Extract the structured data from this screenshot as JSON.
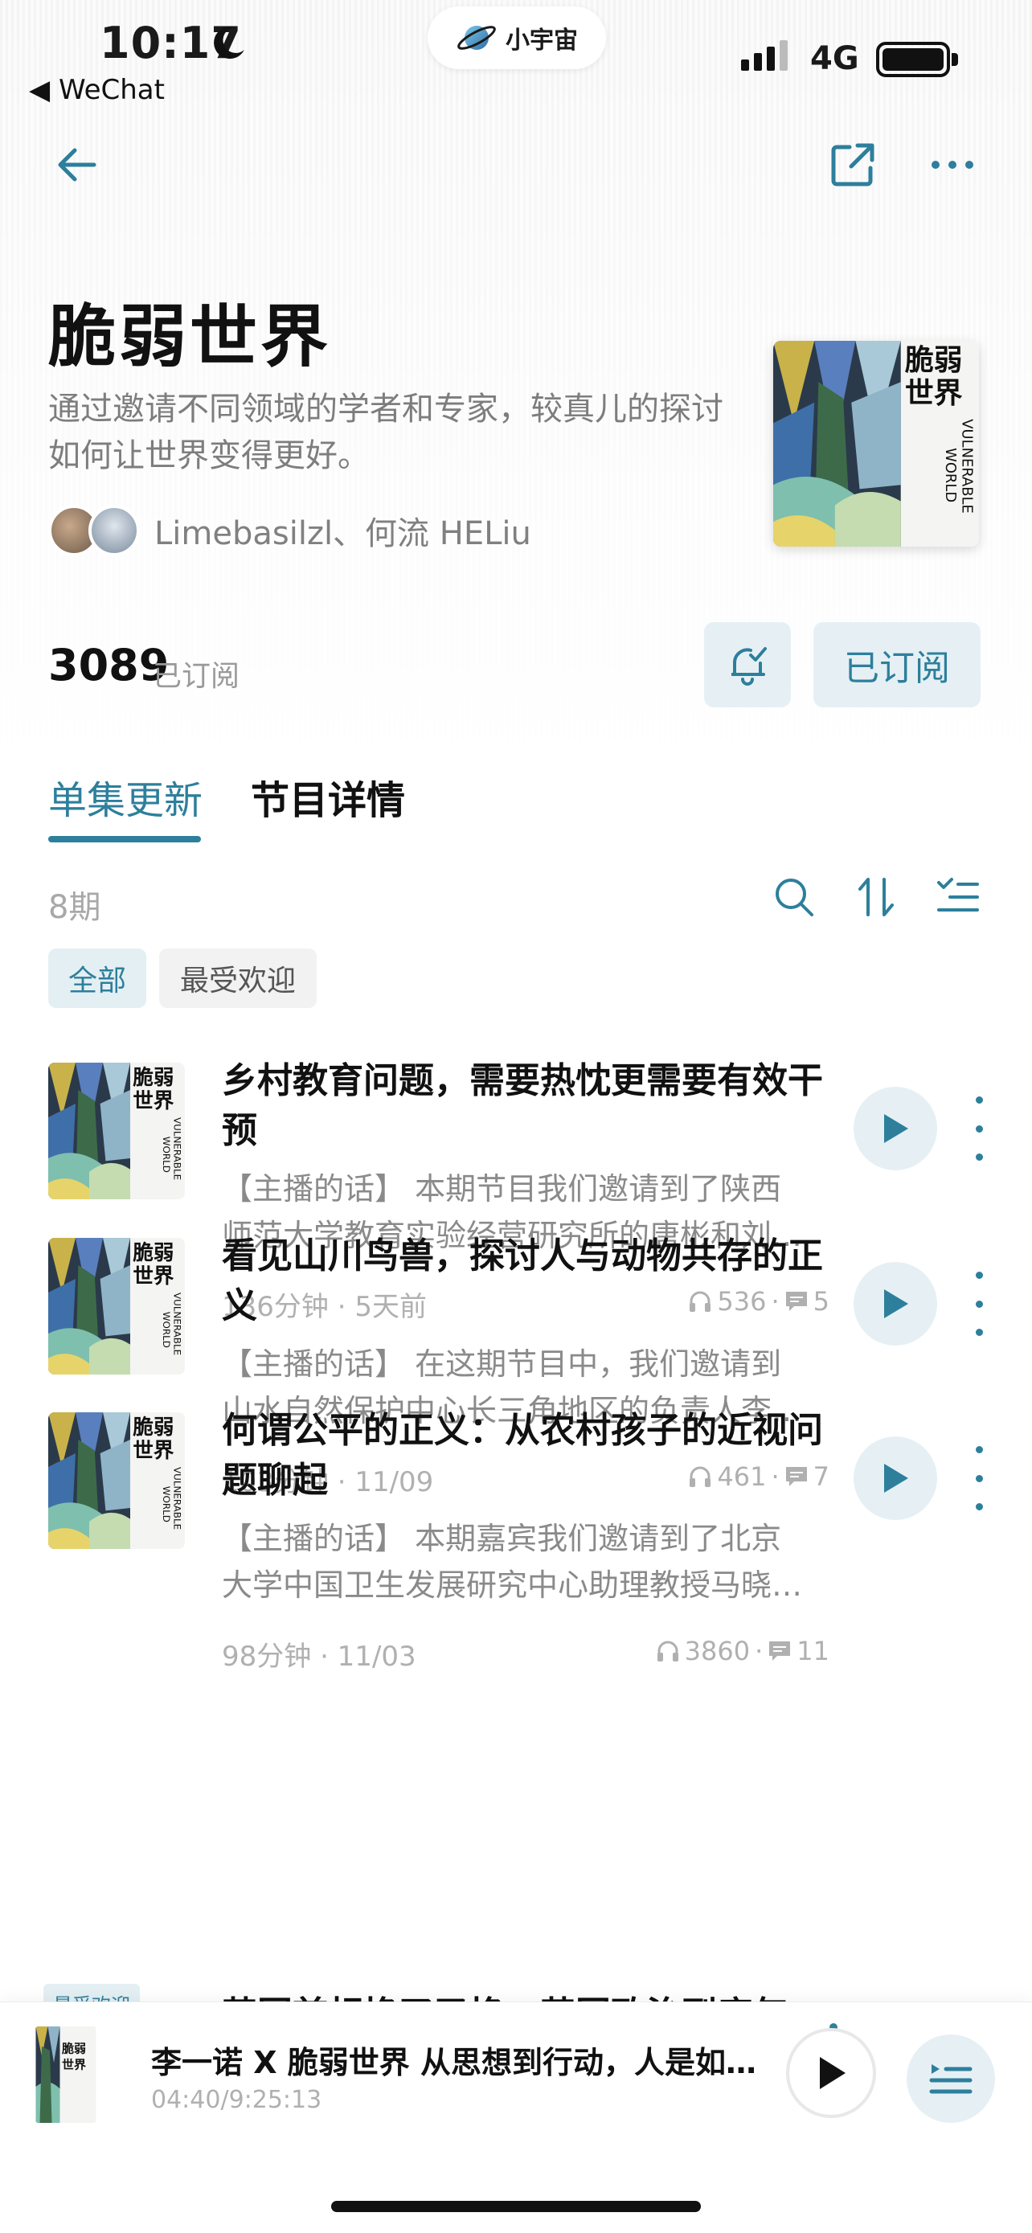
{
  "status_bar": {
    "time": "10:17",
    "back_app": "WeChat",
    "network": "4G"
  },
  "app_pill": {
    "name": "小宇宙"
  },
  "podcast": {
    "title": "脆弱世界",
    "description": "通过邀请不同领域的学者和专家，较真儿的探讨如何让世界变得更好。",
    "hosts": "Limebasilzl、何流 HELiu",
    "subscriber_count": "3089",
    "subscriber_label": "已订阅",
    "subscribed_button": "已订阅",
    "cover_title": "脆弱世界",
    "cover_subtitle": "VULNERABLE WORLD"
  },
  "tabs": [
    {
      "label": "单集更新",
      "active": true
    },
    {
      "label": "节目详情",
      "active": false
    }
  ],
  "episode_count": "8期",
  "filters": [
    {
      "label": "全部",
      "active": true
    },
    {
      "label": "最受欢迎",
      "active": false
    }
  ],
  "episodes": [
    {
      "title": "乡村教育问题，需要热忱更需要有效干预",
      "desc_line1": "【主播的话】 本期节目我们邀请到了陕西",
      "desc_line2": "师范大学教育实验经营研究所的唐彬和刘…",
      "meta": "136分钟 · 5天前",
      "plays": "536",
      "comments": "5"
    },
    {
      "title": "看见山川鸟兽，探讨人与动物共存的正义",
      "desc_line1": "【主播的话】 在这期节目中，我们邀请到",
      "desc_line2": "山水自然保护中心长三角地区的负责人李…",
      "meta": "103分钟 · 11/09",
      "plays": "461",
      "comments": "7"
    },
    {
      "title": "何谓公平的正义：从农村孩子的近视问题聊起",
      "desc_line1": "【主播的话】 本期嘉宾我们邀请到了北京",
      "desc_line2": "大学中国卫生发展研究中心助理教授马晓…",
      "meta": "98分钟 · 11/03",
      "plays": "3860",
      "comments": "11"
    }
  ],
  "peek_episode": {
    "badge": "最受欢迎",
    "title": "英国首相换了又换，英国政治到底怎"
  },
  "now_playing": {
    "title": "李一诺 X 脆弱世界 从思想到行动，人是如…",
    "time": "04:40/9:25:13"
  },
  "colors": {
    "accent": "#2d7f9c",
    "accent_bg": "#e6f0f4"
  }
}
